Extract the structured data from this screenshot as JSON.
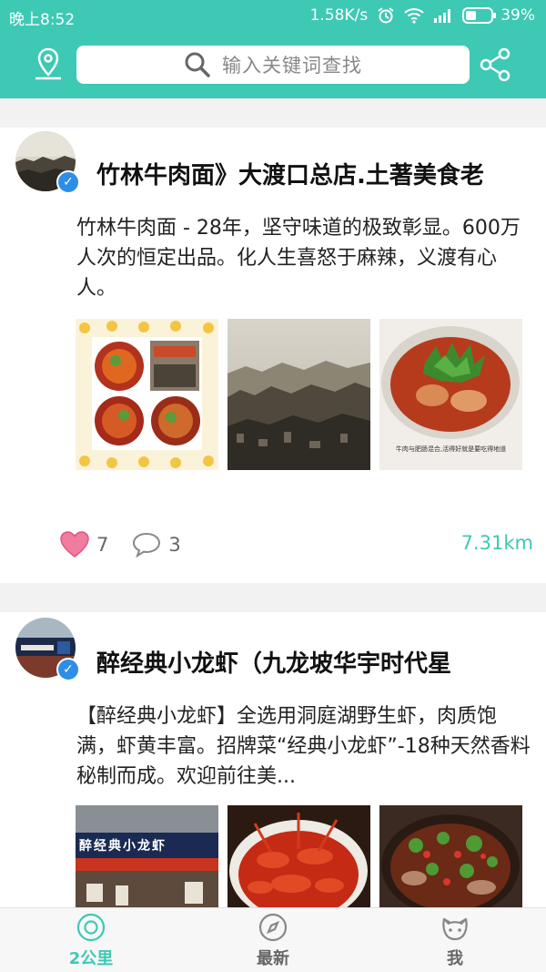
{
  "status": {
    "time": "晚上8:52",
    "speed": "1.58K/s",
    "battery": "39%"
  },
  "search": {
    "placeholder": "输入关键词查找"
  },
  "posts": [
    {
      "title": "竹林牛肉面》大渡口总店.土著美食老",
      "desc": "竹林牛肉面 - 28年，坚守味道的极致彰显。600万人次的恒定出品。化人生喜怒于麻辣，义渡有心人。",
      "image_caption": "牛肉与肥肠混合,活得好就是要吃得地道",
      "likes": "7",
      "comments": "3",
      "distance": "7.31km"
    },
    {
      "title": "醉经典小龙虾（九龙坡华宇时代星",
      "desc": "【醉经典小龙虾】全选用洞庭湖野生虾，肉质饱满，虾黄丰富。招牌菜“经典小龙虾”-18种天然香料秘制而成。欢迎前往美...",
      "image_sign": "醉经典小龙虾"
    }
  ],
  "nav": {
    "tab1": "2公里",
    "tab2": "最新",
    "tab3": "我"
  },
  "colors": {
    "accent": "#3ec9b5",
    "verified": "#2d8ee8",
    "like": "#f07ca0"
  }
}
